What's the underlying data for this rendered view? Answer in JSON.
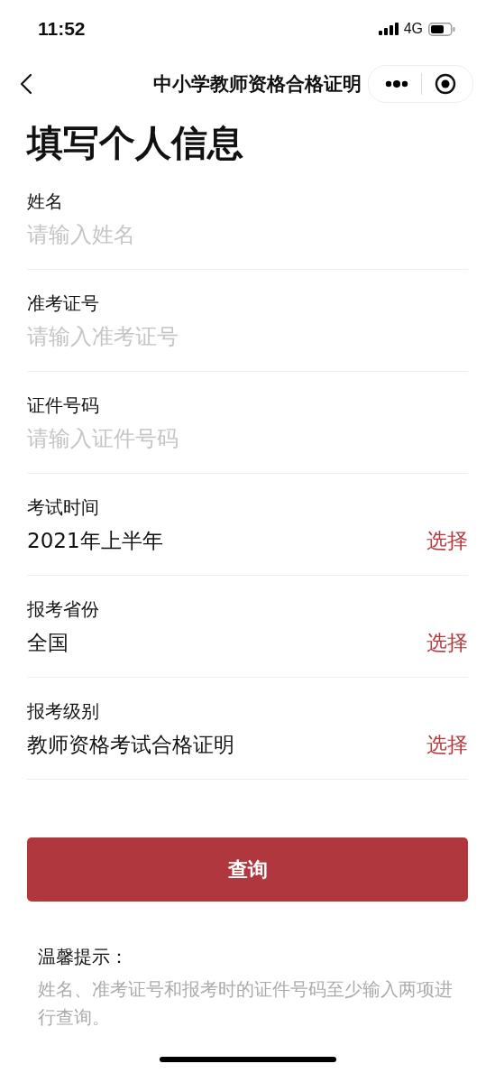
{
  "status_bar": {
    "time": "11:52",
    "network": "4G"
  },
  "nav_bar": {
    "title": "中小学教师资格合格证明"
  },
  "heading": "填写个人信息",
  "fields": [
    {
      "kind": "input",
      "label": "姓名",
      "placeholder": "请输入姓名"
    },
    {
      "kind": "input",
      "label": "准考证号",
      "placeholder": "请输入准考证号"
    },
    {
      "kind": "input",
      "label": "证件号码",
      "placeholder": "请输入证件号码"
    },
    {
      "kind": "select",
      "label": "考试时间",
      "value": "2021年上半年",
      "action": "选择"
    },
    {
      "kind": "select",
      "label": "报考省份",
      "value": "全国",
      "action": "选择"
    },
    {
      "kind": "select",
      "label": "报考级别",
      "value": "教师资格考试合格证明",
      "action": "选择"
    }
  ],
  "submit_button": "查询",
  "tips": {
    "title": "温馨提示：",
    "text": "姓名、准考证号和报考时的证件号码至少输入两项进行查询。"
  }
}
